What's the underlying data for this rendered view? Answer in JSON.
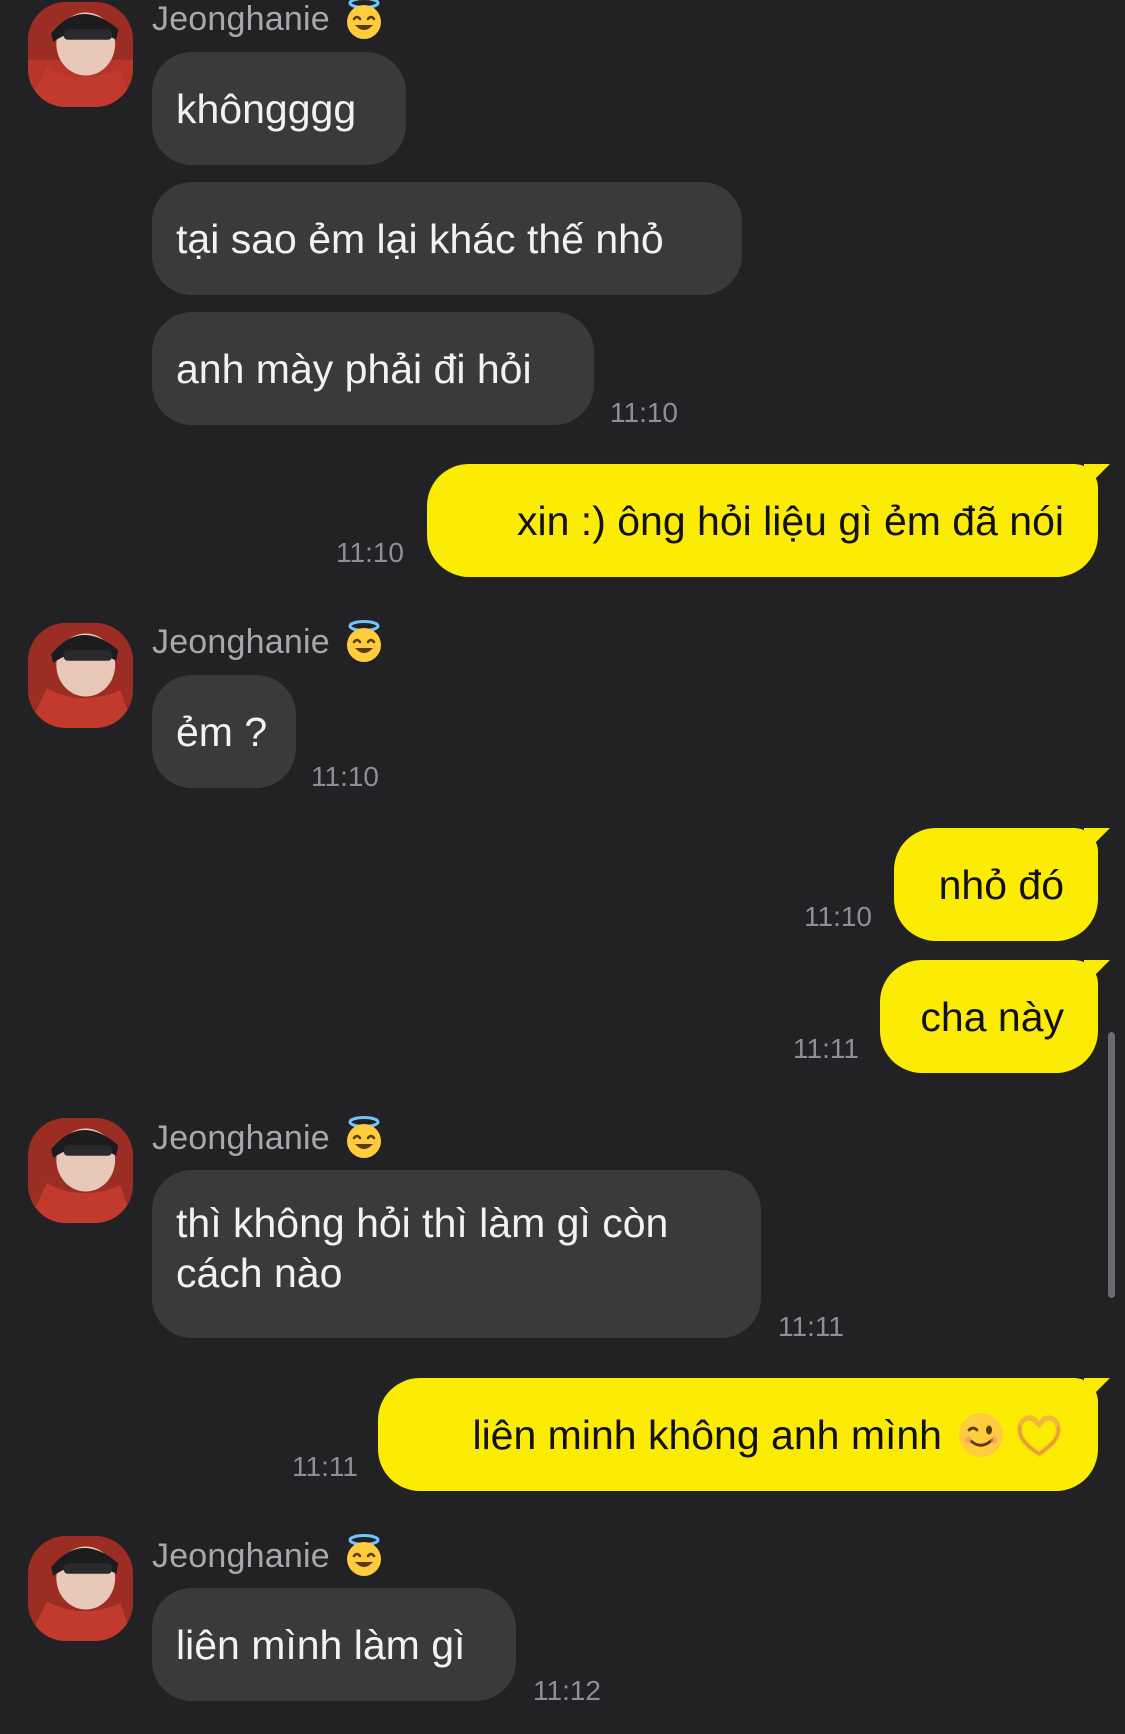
{
  "colors": {
    "background": "#222225",
    "incoming_bubble": "#3a3a3d",
    "outgoing_bubble": "#fcec04",
    "time_text": "#8f8f93",
    "sender_text": "#a8a8ab"
  },
  "sender_name": "Jeonghanie",
  "sender_badge_icon": "smiling-face-with-halo",
  "groups": [
    {
      "messages": [
        "khôngggg",
        "tại sao ẻm lại khác thế nhỏ",
        "anh mày phải đi hỏi"
      ],
      "time": "11:10"
    },
    {
      "messages": [
        "ẻm ?"
      ],
      "time": "11:10"
    },
    {
      "messages": [
        "thì không hỏi thì làm gì còn cách nào"
      ],
      "time": "11:11"
    },
    {
      "messages": [
        "liên mình làm gì"
      ],
      "time": "11:12"
    }
  ],
  "outgoing": [
    {
      "text": "xin :) ông hỏi liệu gì ẻm đã nói",
      "time": "11:10"
    },
    {
      "text": "nhỏ đó",
      "time": "11:10"
    },
    {
      "text": "cha này",
      "time": "11:11"
    },
    {
      "text": "liên minh không anh mình",
      "emojis": [
        "winking-face",
        "heart-hands"
      ],
      "time": "11:11"
    }
  ]
}
